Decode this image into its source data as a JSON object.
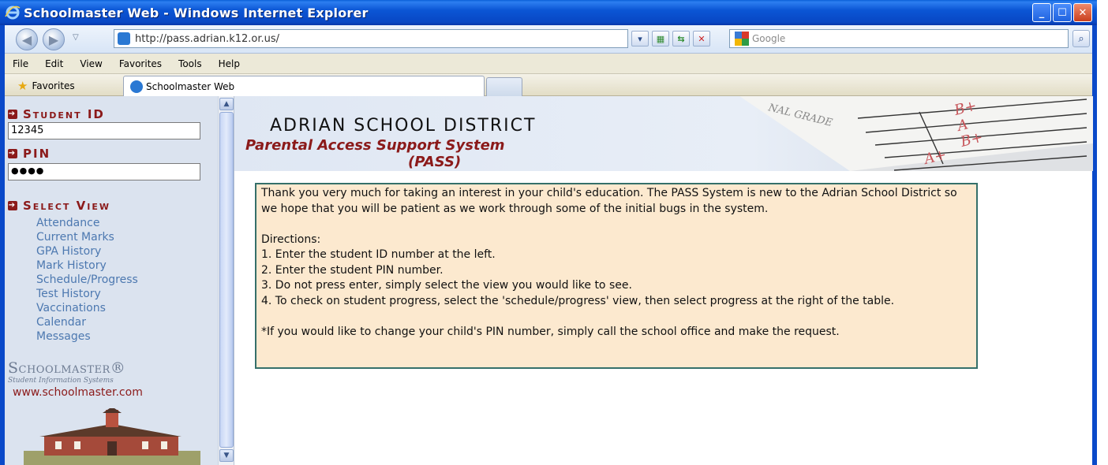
{
  "window": {
    "title": "Schoolmaster Web - Windows Internet Explorer",
    "min_label": "_",
    "max_label": "☐",
    "close_label": "✕"
  },
  "address": {
    "url": "http://pass.adrian.k12.or.us/",
    "search_placeholder": "Google"
  },
  "menu": [
    "File",
    "Edit",
    "View",
    "Favorites",
    "Tools",
    "Help"
  ],
  "favorites": {
    "label": "Favorites",
    "tab_label": "Schoolmaster Web"
  },
  "sidebar": {
    "student_id_label": "Student ID",
    "student_id_value": "12345",
    "pin_label": "PIN",
    "pin_value": "●●●●",
    "select_view_label": "Select View",
    "links": [
      "Attendance",
      "Current Marks",
      "GPA History",
      "Mark History",
      "Schedule/Progress",
      "Test History",
      "Vaccinations",
      "Calendar",
      "Messages"
    ],
    "brand": "Schoolmaster®",
    "brand_sub": "Student Information Systems",
    "brand_url": "www.schoolmaster.com"
  },
  "banner": {
    "district": "ADRIAN SCHOOL DISTRICT",
    "subtitle_line1": "Parental Access Support System",
    "subtitle_line2": "(PASS)",
    "paper_text": "NAL GRADE",
    "grades": [
      "B+",
      "A",
      "B+",
      "A+"
    ]
  },
  "info": {
    "intro": "Thank you very much for taking an interest in your child's education. The PASS System is new to the Adrian School District so we hope that you will be patient as we work through some of the initial bugs in the system.",
    "directions_label": "Directions:",
    "steps": [
      "1. Enter the student ID number at the left.",
      "2. Enter the student PIN number.",
      "3. Do not press enter, simply select the view you would like to see.",
      "4. To check on student progress, select the 'schedule/progress' view, then select progress at the right of the table."
    ],
    "note": "*If you would like to change your child's PIN number, simply call the school office and make the request."
  },
  "colors": {
    "accent_red": "#8b1a1a",
    "link_blue": "#4c78b0",
    "info_bg": "#fce9cf",
    "info_border": "#35706a"
  }
}
